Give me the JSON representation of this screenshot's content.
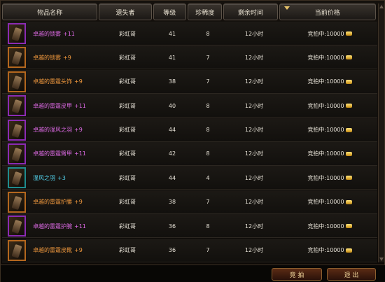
{
  "columns": {
    "item": "物品名称",
    "loser": "遗失者",
    "level": "等级",
    "rarity": "珍稀度",
    "time": "剩余时间",
    "price": "当前价格"
  },
  "items": [
    {
      "name": "卓越的锁雾",
      "plus": "+11",
      "loser": "彩虹哥",
      "level": "41",
      "rarity": "8",
      "time": "12小时",
      "price": "竞拍中:10000",
      "color": "purple"
    },
    {
      "name": "卓越的锁雾",
      "plus": "+9",
      "loser": "彩虹哥",
      "level": "41",
      "rarity": "7",
      "time": "12小时",
      "price": "竞拍中:10000",
      "color": "orange"
    },
    {
      "name": "卓越的雷霆头饰",
      "plus": "+9",
      "loser": "彩虹哥",
      "level": "38",
      "rarity": "7",
      "time": "12小时",
      "price": "竞拍中:10000",
      "color": "orange"
    },
    {
      "name": "卓越的雷霆皮甲",
      "plus": "+11",
      "loser": "彩虹哥",
      "level": "40",
      "rarity": "8",
      "time": "12小时",
      "price": "竞拍中:10000",
      "color": "purple"
    },
    {
      "name": "卓越的湿风之羽",
      "plus": "+9",
      "loser": "彩虹哥",
      "level": "44",
      "rarity": "8",
      "time": "12小时",
      "price": "竞拍中:10000",
      "color": "purple"
    },
    {
      "name": "卓越的雷霆臂甲",
      "plus": "+11",
      "loser": "彩虹哥",
      "level": "42",
      "rarity": "8",
      "time": "12小时",
      "price": "竞拍中:10000",
      "color": "purple"
    },
    {
      "name": "湿风之羽",
      "plus": "+3",
      "loser": "彩虹哥",
      "level": "44",
      "rarity": "4",
      "time": "12小时",
      "price": "竞拍中:10000",
      "color": "cyan"
    },
    {
      "name": "卓越的雷霆护腰",
      "plus": "+9",
      "loser": "彩虹哥",
      "level": "38",
      "rarity": "7",
      "time": "12小时",
      "price": "竞拍中:10000",
      "color": "orange"
    },
    {
      "name": "卓越的雷霆护腕",
      "plus": "+11",
      "loser": "彩虹哥",
      "level": "36",
      "rarity": "8",
      "time": "12小时",
      "price": "竞拍中:10000",
      "color": "purple"
    },
    {
      "name": "卓越的雷霆皮靴",
      "plus": "+9",
      "loser": "彩虹哥",
      "level": "36",
      "rarity": "7",
      "time": "12小时",
      "price": "竞拍中:10000",
      "color": "orange"
    }
  ],
  "buttons": {
    "bid": "竞 拍",
    "exit": "退 出"
  },
  "icons": {
    "sort": "sort-down-icon",
    "coin": "gold-coin-icon",
    "item": "equipment-icon"
  },
  "colors": {
    "purple": "#e06be8",
    "orange": "#f39a3e",
    "cyan": "#55d8f3"
  }
}
